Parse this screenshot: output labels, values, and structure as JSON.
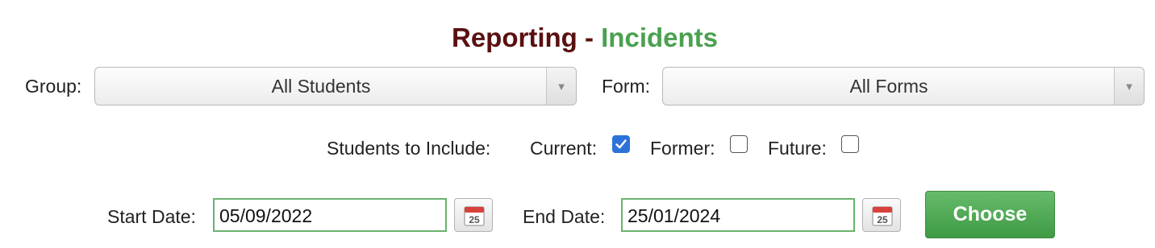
{
  "title": {
    "part1": "Reporting - ",
    "part2": "Incidents"
  },
  "group": {
    "label": "Group:",
    "value": "All Students"
  },
  "form": {
    "label": "Form:",
    "value": "All Forms"
  },
  "students": {
    "label": "Students to Include:",
    "current": {
      "label": "Current:",
      "checked": true
    },
    "former": {
      "label": "Former:",
      "checked": false
    },
    "future": {
      "label": "Future:",
      "checked": false
    }
  },
  "dates": {
    "start_label": "Start Date:",
    "start_value": "05/09/2022",
    "end_label": "End Date:",
    "end_value": "25/01/2024",
    "calendar_day": "25"
  },
  "choose_label": "Choose",
  "colors": {
    "title_dark": "#5a1010",
    "title_green": "#4aa150",
    "accent_green": "#4caf50",
    "checkbox_blue": "#2c73d9"
  },
  "icons": {
    "dropdown": "triangle-down-icon",
    "calendar": "calendar-icon",
    "check": "checkmark-icon"
  }
}
